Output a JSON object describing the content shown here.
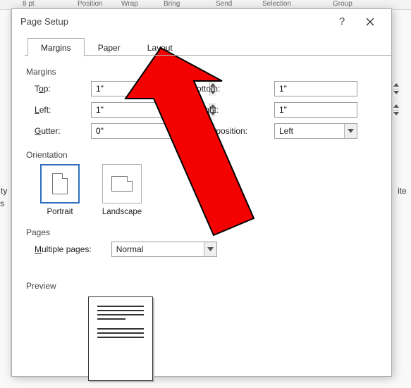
{
  "background": {
    "ribbon": {
      "font_size": "8 pt",
      "position": "Position",
      "wrap": "Wrap",
      "bring": "Bring",
      "send": "Send",
      "selection": "Selection",
      "group": "Group"
    },
    "left": {
      "ty": "ty",
      "s": "s"
    },
    "right": {
      "ite": "ite"
    }
  },
  "dialog": {
    "title": "Page Setup",
    "tabs": {
      "margins": "Margins",
      "paper": "Paper",
      "layout": "Layout"
    },
    "sections": {
      "margins": "Margins",
      "orientation": "Orientation",
      "pages": "Pages",
      "preview": "Preview"
    },
    "margins": {
      "top_label_pre": "T",
      "top_label_u": "o",
      "top_label_post": "p:",
      "top_value": "1\"",
      "bottom_label_post": "ottom:",
      "bottom_value": "1\"",
      "left_label_u": "L",
      "left_label_post": "eft:",
      "left_value": "1\"",
      "right_label_u": "R",
      "right_label_post": "ight:",
      "right_value": "1\"",
      "gutter_label_u": "G",
      "gutter_label_post": "utter:",
      "gutter_value": "0\"",
      "gutterpos_label": "utter position:",
      "gutterpos_value": "Left"
    },
    "orientation": {
      "portrait": "Portrait",
      "landscape": "Landscape"
    },
    "pages": {
      "multiple_u": "M",
      "multiple_post": "ultiple pages:",
      "value": "Normal"
    }
  }
}
